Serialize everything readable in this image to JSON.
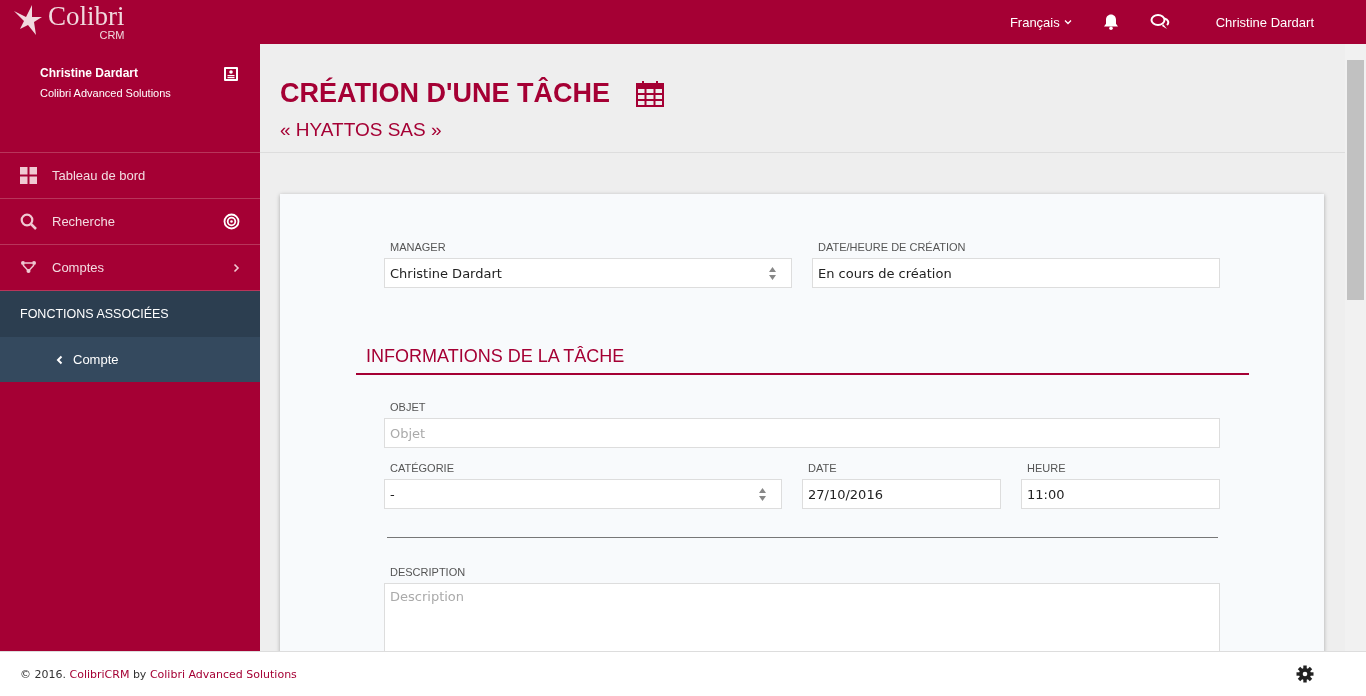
{
  "header": {
    "logo": "Colibri",
    "logo_sub": "CRM",
    "language": "Français",
    "user": "Christine Dardart"
  },
  "sidebar": {
    "profile": {
      "name": "Christine Dardart",
      "company": "Colibri Advanced Solutions"
    },
    "items": [
      {
        "label": "Tableau de bord",
        "kind": "dashboard"
      },
      {
        "label": "Recherche",
        "kind": "search"
      },
      {
        "label": "Comptes",
        "kind": "accounts"
      }
    ],
    "section": "FONCTIONS ASSOCIÉES",
    "sub_items": [
      {
        "label": "Compte"
      }
    ]
  },
  "page": {
    "title": "CRÉATION D'UNE TÂCHE",
    "subtitle": "« HYATTOS SAS »"
  },
  "form": {
    "top_rows": [
      [
        {
          "label": "MANAGER",
          "kind": "select",
          "value": "Christine Dardart"
        },
        {
          "label": "DATE/HEURE DE CRÉATION",
          "kind": "text",
          "value": "En cours de création"
        }
      ]
    ],
    "section_title": "INFORMATIONS DE LA TÂCHE",
    "rows": [
      [
        {
          "label": "OBJET",
          "kind": "text",
          "placeholder": "Objet"
        }
      ],
      [
        {
          "label": "CATÉGORIE",
          "kind": "select",
          "value": "-"
        },
        {
          "label": "DATE",
          "kind": "text",
          "value": "27/10/2016"
        },
        {
          "label": "HEURE",
          "kind": "text",
          "value": "11:00"
        }
      ],
      [
        {
          "kind": "divider"
        }
      ],
      [
        {
          "label": "DESCRIPTION",
          "kind": "textarea",
          "placeholder": "Description"
        }
      ]
    ]
  },
  "footer": {
    "prefix": "© 2016.",
    "brand": "ColibriCRM",
    "by": "by",
    "company": "Colibri Advanced Solutions"
  }
}
